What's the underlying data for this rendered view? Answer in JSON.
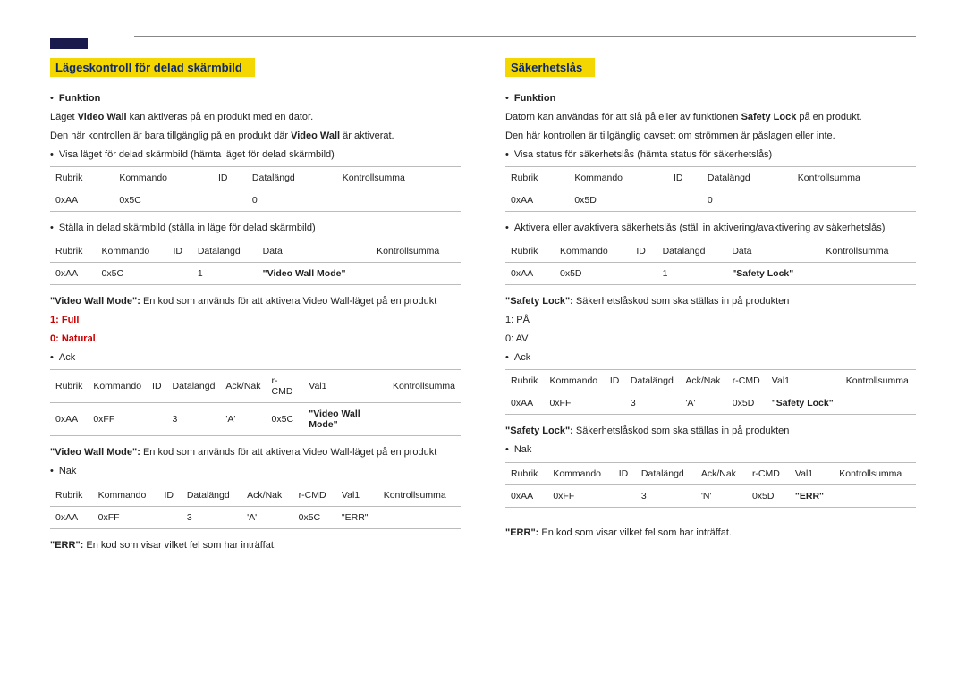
{
  "left": {
    "title": "Lägeskontroll för delad skärmbild",
    "fn_label": "Funktion",
    "fn1": "Läget",
    "fn1_bold": "Video Wall",
    "fn1b": "kan aktiveras på en produkt med en dator.",
    "fn2a": "Den här kontrollen är bara tillgänglig på en produkt där",
    "fn2_bold": "Video Wall",
    "fn2b": "är aktiverat.",
    "get_label": "Visa läget för delad skärmbild (hämta läget för delad skärmbild)",
    "t1": {
      "h": [
        "Rubrik",
        "Kommando",
        "ID",
        "Datalängd",
        "Kontrollsumma"
      ],
      "r": [
        "0xAA",
        "0x5C",
        "",
        "0",
        ""
      ]
    },
    "set_label": "Ställa in delad skärmbild (ställa in läge för delad skärmbild)",
    "t2": {
      "h": [
        "Rubrik",
        "Kommando",
        "ID",
        "Datalängd",
        "Data",
        "Kontrollsumma"
      ],
      "r": [
        "0xAA",
        "0x5C",
        "",
        "1",
        "\"Video Wall Mode\"",
        ""
      ]
    },
    "vwm_label": "\"Video Wall Mode\":",
    "vwm_desc": "En kod som används för att aktivera Video Wall-läget på en produkt",
    "opt1_code": "1:",
    "opt1_text": "Full",
    "opt0_code": "0:",
    "opt0_text": "Natural",
    "ack_label": "Ack",
    "t3": {
      "h": [
        "Rubrik",
        "Kommando",
        "ID",
        "Datalängd",
        "Ack/Nak",
        "r-CMD",
        "Val1",
        "Kontrollsumma"
      ],
      "r": [
        "0xAA",
        "0xFF",
        "",
        "3",
        "'A'",
        "0x5C",
        "\"Video Wall Mode\"",
        ""
      ]
    },
    "vwm2_label": "\"Video Wall Mode\":",
    "vwm2_desc": "En kod som används för att aktivera Video Wall-läget på en produkt",
    "nak_label": "Nak",
    "t4": {
      "h": [
        "Rubrik",
        "Kommando",
        "ID",
        "Datalängd",
        "Ack/Nak",
        "r-CMD",
        "Val1",
        "Kontrollsumma"
      ],
      "r": [
        "0xAA",
        "0xFF",
        "",
        "3",
        "'A'",
        "0x5C",
        "\"ERR\"",
        ""
      ]
    },
    "err_label": "\"ERR\":",
    "err_desc": "En kod som visar vilket fel som har inträffat."
  },
  "right": {
    "title": "Säkerhetslås",
    "fn_label": "Funktion",
    "fn1a": "Datorn kan användas för att slå på eller av funktionen",
    "fn1_bold": "Safety Lock",
    "fn1b": "på en produkt.",
    "fn2": "Den här kontrollen är tillgänglig oavsett om strömmen är påslagen eller inte.",
    "get_label": "Visa status för säkerhetslås (hämta status för säkerhetslås)",
    "t1": {
      "h": [
        "Rubrik",
        "Kommando",
        "ID",
        "Datalängd",
        "Kontrollsumma"
      ],
      "r": [
        "0xAA",
        "0x5D",
        "",
        "0",
        ""
      ]
    },
    "set_label": "Aktivera eller avaktivera säkerhetslås (ställ in aktivering/avaktivering av säkerhetslås)",
    "t2": {
      "h": [
        "Rubrik",
        "Kommando",
        "ID",
        "Datalängd",
        "Data",
        "Kontrollsumma"
      ],
      "r": [
        "0xAA",
        "0x5D",
        "",
        "1",
        "\"Safety Lock\"",
        ""
      ]
    },
    "sl_label": "\"Safety Lock\":",
    "sl_desc": "Säkerhetslåskod som ska ställas in på produkten",
    "opt1_code": "1:",
    "opt1_text": "PÅ",
    "opt0_code": "0:",
    "opt0_text": "AV",
    "ack_label": "Ack",
    "t3": {
      "h": [
        "Rubrik",
        "Kommando",
        "ID",
        "Datalängd",
        "Ack/Nak",
        "r-CMD",
        "Val1",
        "Kontrollsumma"
      ],
      "r": [
        "0xAA",
        "0xFF",
        "",
        "3",
        "'A'",
        "0x5D",
        "\"Safety Lock\"",
        ""
      ]
    },
    "sl2_label": "\"Safety Lock\":",
    "sl2_desc": "Säkerhetslåskod som ska ställas in på produkten",
    "nak_label": "Nak",
    "t4": {
      "h": [
        "Rubrik",
        "Kommando",
        "ID",
        "Datalängd",
        "Ack/Nak",
        "r-CMD",
        "Val1",
        "Kontrollsumma"
      ],
      "r": [
        "0xAA",
        "0xFF",
        "",
        "3",
        "'N'",
        "0x5D",
        "\"ERR\"",
        ""
      ]
    },
    "err_label": "\"ERR\":",
    "err_desc": "En kod som visar vilket fel som har inträffat."
  }
}
